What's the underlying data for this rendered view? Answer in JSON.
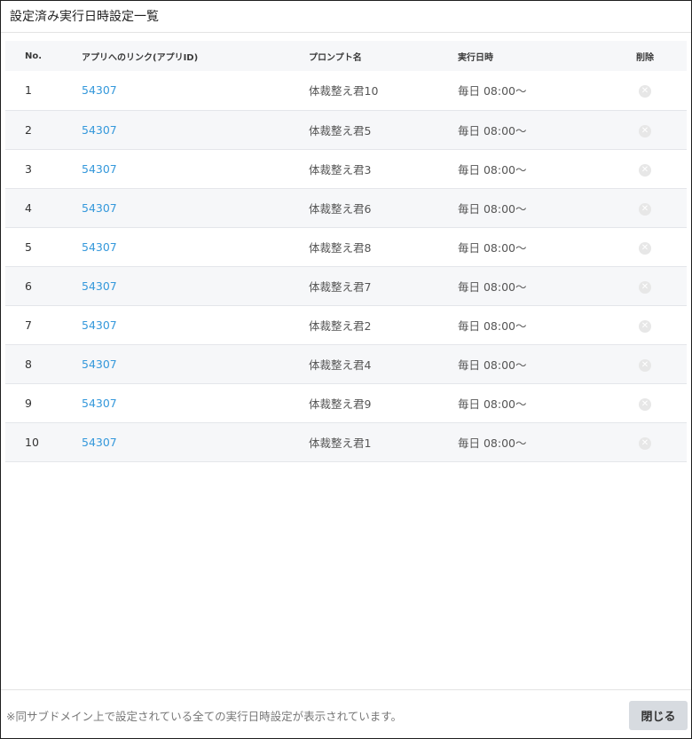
{
  "dialog": {
    "title": "設定済み実行日時設定一覧",
    "footer_note": "※同サブドメイン上で設定されている全ての実行日時設定が表示されています。",
    "close_label": "閉じる"
  },
  "table": {
    "headers": {
      "no": "No.",
      "app_link": "アプリへのリンク(アプリID)",
      "prompt": "プロンプト名",
      "schedule": "実行日時",
      "delete": "削除"
    },
    "rows": [
      {
        "no": "1",
        "app_id": "54307",
        "prompt": "体裁整え君10",
        "schedule": "毎日 08:00〜"
      },
      {
        "no": "2",
        "app_id": "54307",
        "prompt": "体裁整え君5",
        "schedule": "毎日 08:00〜"
      },
      {
        "no": "3",
        "app_id": "54307",
        "prompt": "体裁整え君3",
        "schedule": "毎日 08:00〜"
      },
      {
        "no": "4",
        "app_id": "54307",
        "prompt": "体裁整え君6",
        "schedule": "毎日 08:00〜"
      },
      {
        "no": "5",
        "app_id": "54307",
        "prompt": "体裁整え君8",
        "schedule": "毎日 08:00〜"
      },
      {
        "no": "6",
        "app_id": "54307",
        "prompt": "体裁整え君7",
        "schedule": "毎日 08:00〜"
      },
      {
        "no": "7",
        "app_id": "54307",
        "prompt": "体裁整え君2",
        "schedule": "毎日 08:00〜"
      },
      {
        "no": "8",
        "app_id": "54307",
        "prompt": "体裁整え君4",
        "schedule": "毎日 08:00〜"
      },
      {
        "no": "9",
        "app_id": "54307",
        "prompt": "体裁整え君9",
        "schedule": "毎日 08:00〜"
      },
      {
        "no": "10",
        "app_id": "54307",
        "prompt": "体裁整え君1",
        "schedule": "毎日 08:00〜"
      }
    ]
  },
  "colors": {
    "link": "#3498db",
    "stripe": "#f6f7f9",
    "close_button_bg": "#d7dbe0"
  },
  "icons": {
    "delete": "close-circle-icon"
  }
}
